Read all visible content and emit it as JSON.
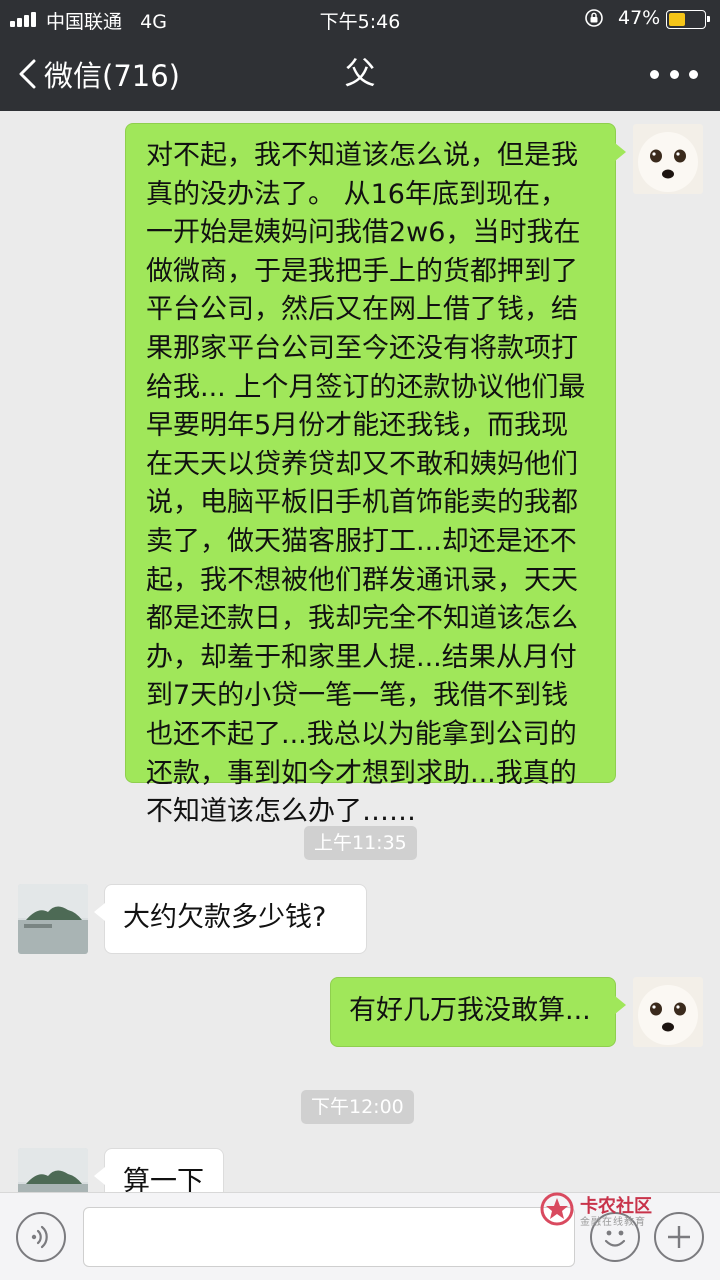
{
  "status_bar": {
    "carrier": "中国联通",
    "network": "4G",
    "time": "下午5:46",
    "battery_percent": "47%",
    "battery_level": 0.47
  },
  "nav": {
    "back_label": "微信(716)",
    "title": "父"
  },
  "messages": [
    {
      "direction": "outgoing",
      "lines": [
        "对不起，我不知道该怎么说，但是我",
        "真的没办法了。 从16年底到现在，",
        "一开始是姨妈问我借2w6，当时我在",
        "做微商，于是我把手上的货都押到了",
        "平台公司，然后又在网上借了钱，结",
        "果那家平台公司至今还没有将款项打",
        "给我... 上个月签订的还款协议他们最",
        "早要明年5月份才能还我钱，而我现",
        "在天天以贷养贷却又不敢和姨妈他们",
        "说，电脑平板旧手机首饰能卖的我都",
        "卖了，做天猫客服打工...却还是还不",
        "起，我不想被他们群发通讯录，天天",
        "都是还款日，我却完全不知道该怎么",
        "办，却羞于和家里人提...结果从月付",
        "到7天的小贷一笔一笔，我借不到钱",
        "也还不起了...我总以为能拿到公司的",
        "还款，事到如今才想到求助...我真的",
        "不知道该怎么办了……"
      ]
    },
    {
      "timestamp": "上午11:35"
    },
    {
      "direction": "incoming",
      "text": "大约欠款多少钱?"
    },
    {
      "direction": "outgoing",
      "text": "有好几万我没敢算..."
    },
    {
      "timestamp": "下午12:00"
    },
    {
      "direction": "incoming",
      "text": "算一下"
    }
  ],
  "watermark": {
    "title": "卡农社区",
    "subtitle": "金融在线教育"
  },
  "icons": {
    "back": "chevron-left-icon",
    "more": "more-dots-icon",
    "voice": "voice-icon",
    "emoji": "emoji-icon",
    "plus": "plus-icon"
  }
}
